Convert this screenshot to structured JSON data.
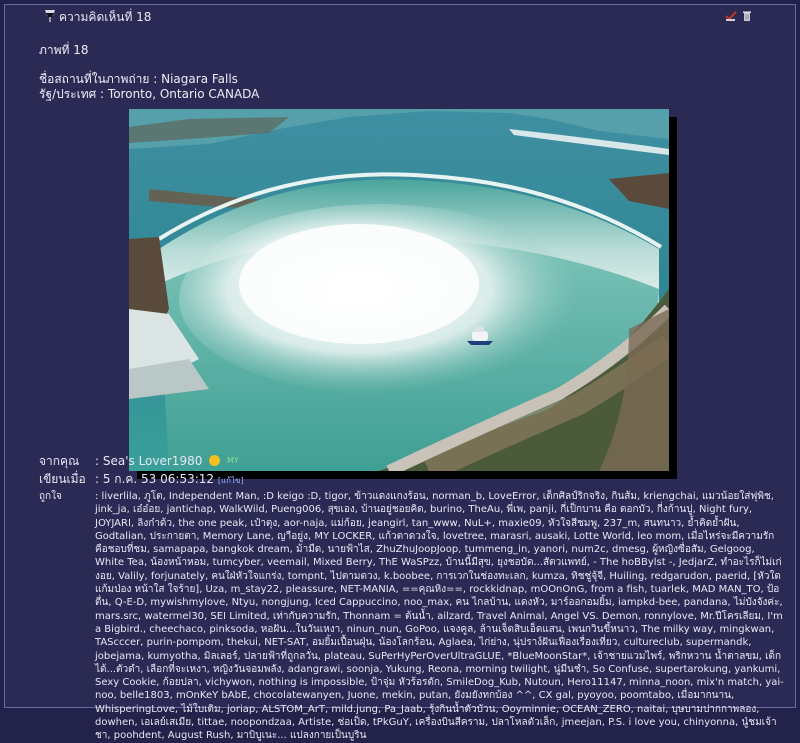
{
  "header": {
    "title": "ความคิดเห็นที่ 18"
  },
  "post": {
    "heading": "ภาพที่ 18",
    "place_label": "ชื่อสถานที่ในภาพถ่าย : Niagara Falls",
    "country_label": "รัฐ/ประเทศ : Toronto, Ontario CANADA"
  },
  "photo": {
    "alt": "Niagara Falls (Horseshoe Falls) aerial view with tour boat"
  },
  "meta": {
    "from_label": "จากคุณ",
    "from_value": ": Sea's Lover1980",
    "my_badge": "MY",
    "written_label": "เขียนเมื่อ",
    "written_value": ": 5 ก.ค. 53 06:53:12",
    "edit_text": "[แก้ไข]",
    "likes_label": "ถูกใจ",
    "likes_value": ": liverlila, ภูโต, Independent Man, :D keigo :D, tigor, ข้าวแดงแกงร้อน, norman_b, LoveError, เด็กศิลป์ริกจริง, กินส้ม, kriengchai, แมวน้อยใส่ฟุพิช, jink_ja, เอ๋อ๋อย, jantichap, WalkWild, Pueng006, สุขเอง, บ้านอยู่ชอยคิด, burino, TheAu, พี่เพ, panji, กี่เป็กบาน คือ ดอกบัว, กี่งก้านปู, Night fury, JOYJARI, ลิงก๋าด้ว, the one peak, เป๋าตุง, aor-naja, แม่ก้อย, jeangirl, tan_www, NuL+, maxie09, หัวใจสีชมพู, 237_m, สนทนาว, ย้ำคิดย้ำฝัน, Godtalian, ประกายตา, Memory Lane, ญาือยู่ง, MY LOCKER, แก้วตาดวงใจ, lovetree, marasri, ausaki, Lotte World, leo mom, เมื่อไหร่จะมีความรักคือชอบที่ชม, samapapa, bangkok dream, ม้ามืด, นายฟ้าไส, ZhuZhuJoopJoop, tummeng_in, yanori, num2c, dmesg, ผู้หญิงซื่อสัม, Gelgoog, White Tea, น้องหน้าหอม, tumcyber, veemail, Mixed Berry, ThE WaSPzz, บ้านนี้มีสุข, ยุงชอบัด...สัตวแพทย์, - The hoBBylst -, JedjarZ, ทำอะไรก็ไม่เก่งอย, Valily, forjunately, คนใฝ่หัวใจแกร่ง, tompnt, ไปตามดวง, k.boobee, การเวกในช่องทะเลก, kumza, ทิชชู่จุ้จี, Huiling, redgarudon, paerid, [หัวใด แก้มป่อง หน้าใส ใจร้าย], Uza, m_stay22, pleassure, NET-MANIA, ==คุณหิง==, rockkidnap, mOOnOnG, from a fish, tuarlek, MAD MAN_TO, ป้อตื่น, Q-E-D, mywishmylove, Ntyu, nongjung, Iced Cappuccino, noo_max, คน ไกลบ้าน, แดงหัว, มาร์ออกอมยิ้ม, iampkd-bee, pandana, ไม่บังจังค่ะ, mars.src, watermel30, SEI Limited, เท่ากับความรัก, Thonnam = ต้นน้ำ, ailzard, Travel Animal, Angel VS. Demon, ronnylove, Mr.ปีโครเลียม, I'm a Bigbird., cheechaco, pinksoda, หอฝัน...ในวันเหงา, ninun_nun, GoPoo, แจงคูล, ล้านเจ็ดสิบเอ็ดแสน, เพนกวินขี้หนาว, The milky way, mingkwan, TAScccer, purin-pompom, thekui, NET-SAT, อมยิ้มเปื้อนฝุ่น, น้องโลกร้อน, Aglaea, ไก่ย่าง, นุ่ปราง์ฝันเฟื่องเรื่องเที่ยว, cultureclub, supermandk, jobejama, kumyotha, มิลเลอร์, ปลายฟ้าที่ถูกลวั่น, plateau, SuPerHyPerOverUltraGLUE, *BlueMoonStar*, เจ้าชายแวมไพร์, พริกหวาน น้ำตาลขม, เด็กได้...ตัวดำ, เลือกที่จะเหงา, หญิงวันจอมพลัง, adangrawi, soonja, Yukung, Reona, morning twilight, นู่มีนชำ, So Confuse, supertarokung, yankumi, Sexy Cookie, ก้อยปลา, vichywon, nothing is impossible, ป้าจุ่ม หัวร้อรตัก, SmileDog_Kub, Nutoun, Hero11147, minna_noon, mix'n match, yai-noo, belle1803, mOnKeY bAbE, chocolatewanyen, Juone, mekin, putan, ยังมยังทกบ้อง ^^, CX gal, pyoyoo, poomtabo, เมื่อมากนาน, WhisperingLove, ไม้ใบเดิม, joriap, ALSTOM_ArT, mild.jung, Pa_Jaab, รุ้งกินน้ำตัวบัวน, Ooyminnie, OCEAN_ZERO, naitai, บุษบามปากกาพลอง, dowhen, เอเลย์เสเมีย, tittae, noopondzaa, Artiste, ช่อเป็ด, tPkGuY, เครื่องบินสีคราม, ปลาโหลตัวเล็ก, jmeejan, P.S. i love you, chinyonna, นู๋ชมเจ้าชา, poohdent, August Rush, มาบิบูเนะ... แปลงกายเป็นบูริน"
  },
  "colors": {
    "background": "#22224a",
    "panel": "#2a2a55",
    "border": "#6a6aa0",
    "text": "#e6e6f0"
  }
}
